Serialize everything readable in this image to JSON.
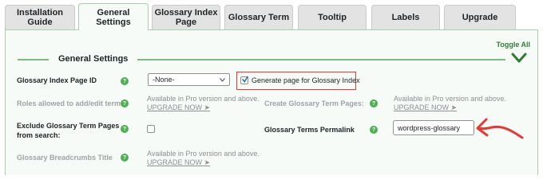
{
  "tabs": [
    {
      "label": "Installation Guide",
      "active": false
    },
    {
      "label": "General Settings",
      "active": true
    },
    {
      "label": "Glossary Index Page",
      "active": false
    },
    {
      "label": "Glossary Term",
      "active": false
    },
    {
      "label": "Tooltip",
      "active": false
    },
    {
      "label": "Labels",
      "active": false
    },
    {
      "label": "Upgrade",
      "active": false
    }
  ],
  "panel": {
    "toggle_all": "Toggle All",
    "section_title": "General Settings"
  },
  "rows": {
    "index_page_id": {
      "label": "Glossary Index Page ID",
      "select_value": "-None-",
      "checkbox_label": "Generate page for Glossary Index",
      "checkbox_checked": true
    },
    "roles": {
      "label": "Roles allowed to add/edit terms:",
      "pro_text": "Available in Pro version and above.",
      "pro_link": "UPGRADE NOW ➤"
    },
    "create_pages": {
      "label": "Create Glossary Term Pages:",
      "pro_text": "Available in Pro version and above.",
      "pro_link": "UPGRADE NOW ➤"
    },
    "exclude": {
      "label_line1": "Exclude Glossary Term Pages",
      "label_line2": "from search:",
      "checkbox_checked": false
    },
    "permalink": {
      "label": "Glossary Terms Permalink",
      "value": "wordpress-glossary"
    },
    "breadcrumbs": {
      "label": "Glossary Breadcrumbs Title",
      "pro_text": "Available in Pro version and above.",
      "pro_link": "UPGRADE NOW ➤"
    }
  },
  "help_glyph": "?",
  "colors": {
    "accent_green": "#4caf50",
    "panel_border": "#a9cfa9",
    "highlight_red": "#e53935"
  }
}
